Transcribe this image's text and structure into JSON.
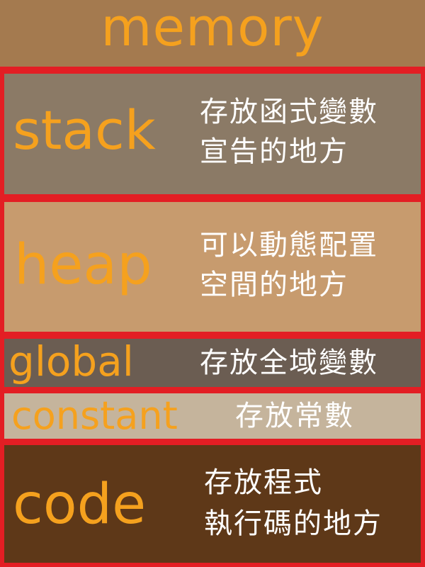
{
  "title": "memory",
  "colors": {
    "label": "#f5a11e",
    "description": "#ffffff",
    "border": "#e31e24",
    "title_band": "#a47a4f"
  },
  "segments": [
    {
      "name": "stack",
      "description": [
        "存放函式變數",
        "宣告的地方"
      ],
      "fill": "#8b7a66"
    },
    {
      "name": "heap",
      "description": [
        "可以動態配置",
        "空間的地方"
      ],
      "fill": "#c79b6e"
    },
    {
      "name": "global",
      "description": [
        "存放全域變數"
      ],
      "fill": "#6b5d52"
    },
    {
      "name": "constant",
      "description": [
        "存放常數"
      ],
      "fill": "#c5b49c"
    },
    {
      "name": "code",
      "description": [
        "存放程式",
        "執行碼的地方"
      ],
      "fill": "#5e3818"
    }
  ]
}
